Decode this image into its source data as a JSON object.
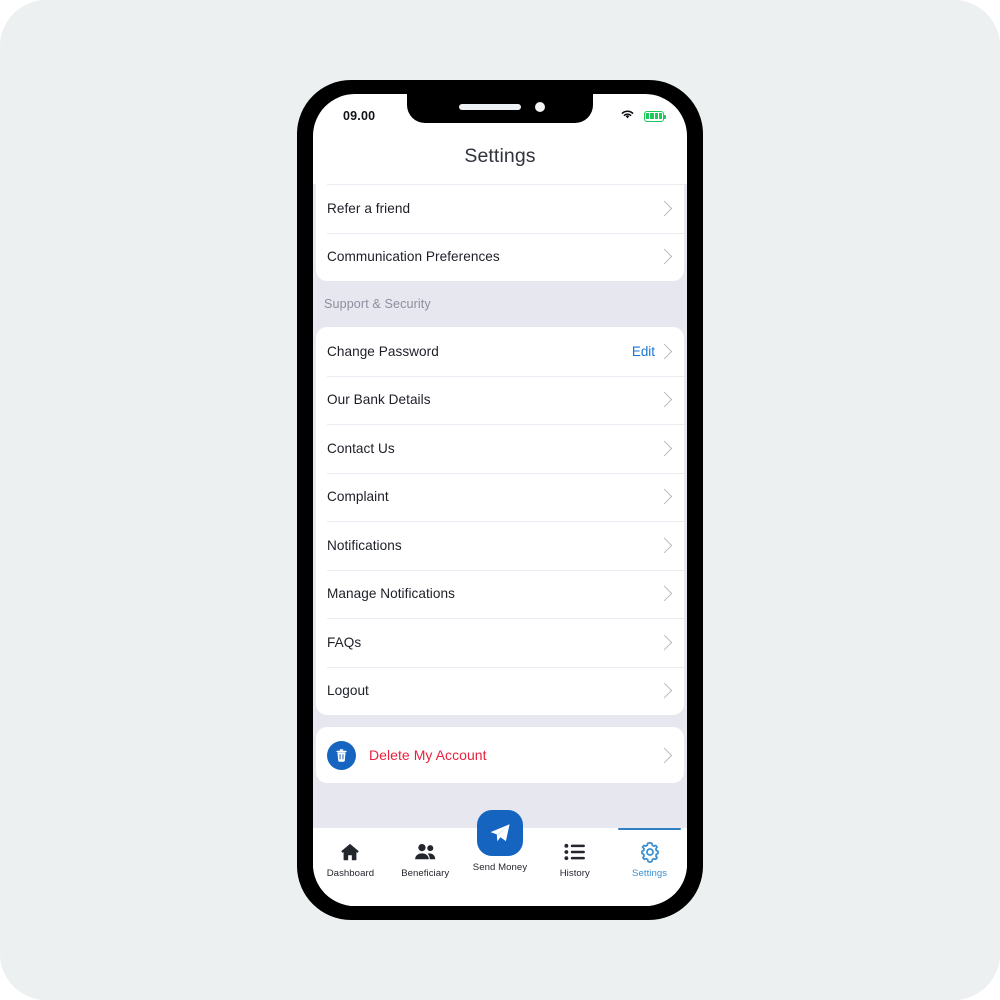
{
  "theme": {
    "page_bg": "#ffffff",
    "canvas_bg": "#ecf0f1",
    "screen_bg": "#e7e7f0",
    "card_bg": "#ffffff",
    "accent_blue": "#1565c0",
    "link_blue": "#1877d2",
    "tab_active_blue": "#3b8fd0",
    "danger_red": "#e8213f",
    "battery_green": "#1ec95a",
    "text_primary": "#1d1f27",
    "text_muted": "#8e8e9e",
    "chevron_grey": "#b9bac3",
    "divider": "#eceaf2"
  },
  "statusbar": {
    "time": "09.00",
    "wifi_icon": "wifi-icon",
    "battery_icon": "battery-full-icon",
    "battery_bars": 4
  },
  "header": {
    "title": "Settings"
  },
  "sections": [
    {
      "id": "account-preferences",
      "header": null,
      "clipped_top": true,
      "rows": [
        {
          "label": "Refer a friend",
          "action": null,
          "chevron": true
        },
        {
          "label": "Communication Preferences",
          "action": null,
          "chevron": true
        }
      ]
    },
    {
      "id": "support-security",
      "header": "Support & Security",
      "clipped_top": false,
      "rows": [
        {
          "label": "Change Password",
          "action": "Edit",
          "chevron": true
        },
        {
          "label": "Our Bank Details",
          "action": null,
          "chevron": true
        },
        {
          "label": "Contact Us",
          "action": null,
          "chevron": true
        },
        {
          "label": "Complaint",
          "action": null,
          "chevron": true
        },
        {
          "label": "Notifications",
          "action": null,
          "chevron": true
        },
        {
          "label": "Manage Notifications",
          "action": null,
          "chevron": true
        },
        {
          "label": "FAQs",
          "action": null,
          "chevron": true
        },
        {
          "label": "Logout",
          "action": null,
          "chevron": true
        }
      ]
    }
  ],
  "delete_account": {
    "label": "Delete My Account",
    "icon": "trash-icon",
    "chevron": true
  },
  "tabbar": {
    "items": [
      {
        "id": "dashboard",
        "label": "Dashboard",
        "icon": "home-icon",
        "active": false,
        "fab": false
      },
      {
        "id": "beneficiary",
        "label": "Beneficiary",
        "icon": "people-icon",
        "active": false,
        "fab": false
      },
      {
        "id": "send-money",
        "label": "Send Money",
        "icon": "paper-plane-icon",
        "active": false,
        "fab": true
      },
      {
        "id": "history",
        "label": "History",
        "icon": "list-icon",
        "active": false,
        "fab": false
      },
      {
        "id": "settings",
        "label": "Settings",
        "icon": "gear-icon",
        "active": true,
        "fab": false
      }
    ]
  }
}
